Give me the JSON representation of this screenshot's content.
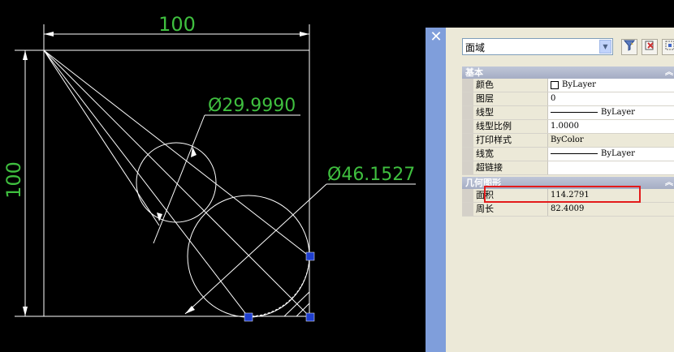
{
  "drawing": {
    "dim_width": "100",
    "dim_height": "100",
    "dim_small_circle": "Ø29.9990",
    "dim_large_circle": "Ø46.1527"
  },
  "palette": {
    "close_icon": "close-icon",
    "object_type": "面域",
    "toolbar_icons": [
      "quick-select-icon",
      "select-objects-icon",
      "toggle-pickadd-icon"
    ],
    "sections": {
      "general": {
        "title": "基本",
        "rows": [
          {
            "name": "颜色",
            "value": "ByLayer"
          },
          {
            "name": "图层",
            "value": "0"
          },
          {
            "name": "线型",
            "value": "ByLayer"
          },
          {
            "name": "线型比例",
            "value": "1.0000"
          },
          {
            "name": "打印样式",
            "value": "ByColor"
          },
          {
            "name": "线宽",
            "value": "ByLayer"
          },
          {
            "name": "超链接",
            "value": ""
          }
        ]
      },
      "geometry": {
        "title": "几何图形",
        "rows": [
          {
            "name": "面积",
            "value": "114.2791"
          },
          {
            "name": "周长",
            "value": "82.4009"
          }
        ]
      }
    },
    "colors": {
      "highlight": "#e31b1b",
      "dimension_text": "#3fbf3f",
      "grip": "#1f3fcf"
    }
  }
}
